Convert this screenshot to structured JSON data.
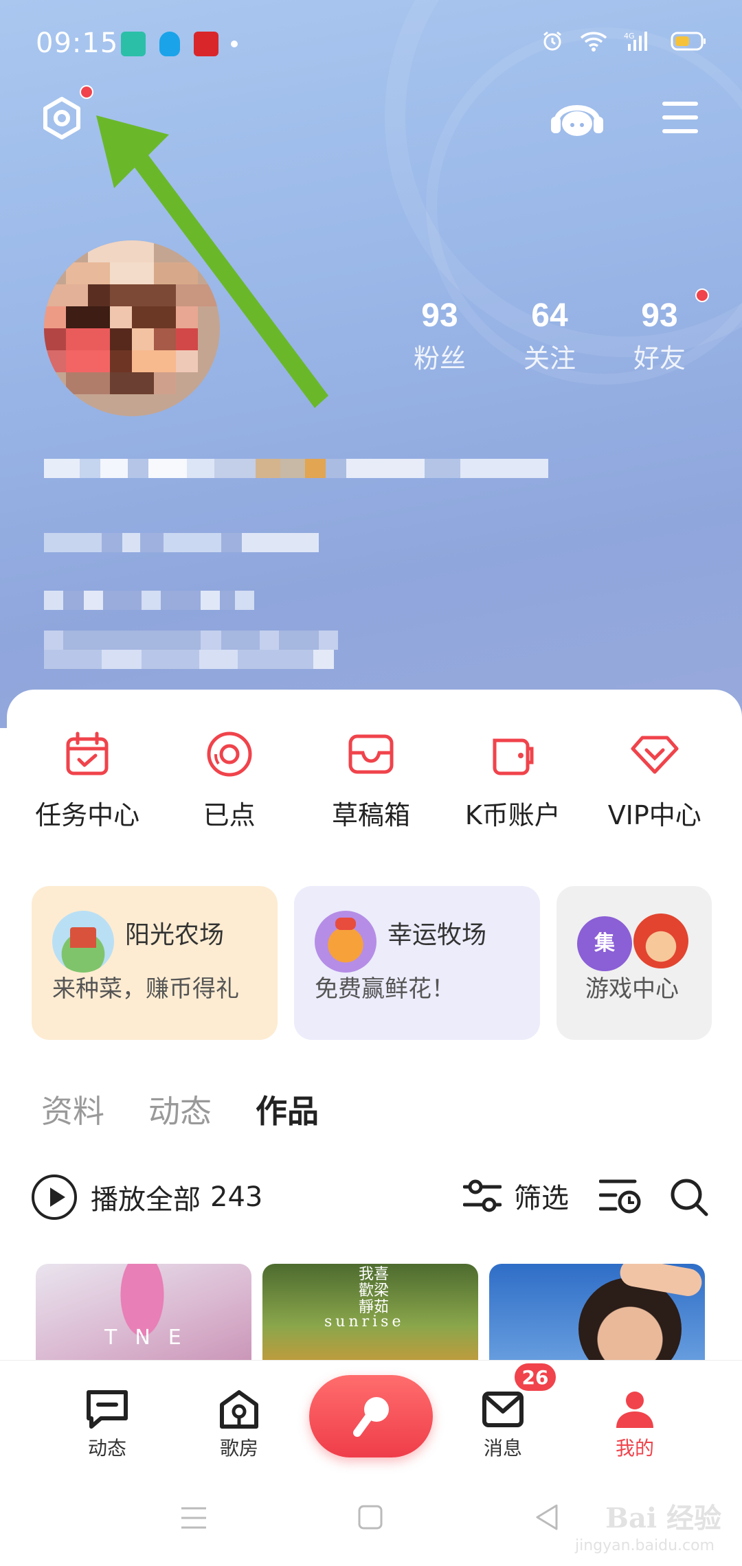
{
  "status_bar": {
    "time": "09:15",
    "app_icons": [
      "boss-zhipin-icon",
      "qq-icon",
      "app-icon",
      "dot"
    ],
    "battery_color": "#f5c23a"
  },
  "header": {
    "settings_icon": "gear-icon",
    "headset_icon": "headset-icon",
    "menu_icon": "menu-icon"
  },
  "profile": {
    "stats": [
      {
        "value": "93",
        "label": "粉丝"
      },
      {
        "value": "64",
        "label": "关注"
      },
      {
        "value": "93",
        "label": "好友"
      }
    ]
  },
  "quick_actions": [
    {
      "label": "任务中心",
      "icon": "calendar-check-icon"
    },
    {
      "label": "已点",
      "icon": "disc-icon"
    },
    {
      "label": "草稿箱",
      "icon": "inbox-icon"
    },
    {
      "label": "K币账户",
      "icon": "wallet-icon"
    },
    {
      "label": "VIP中心",
      "icon": "diamond-icon"
    }
  ],
  "promos": [
    {
      "title": "阳光农场",
      "subtitle": "来种菜，赚币得礼",
      "bg": "#fdecd2"
    },
    {
      "title": "幸运牧场",
      "subtitle": "免费赢鲜花！",
      "bg": "#ececfb"
    },
    {
      "title": "",
      "subtitle": "游戏中心",
      "bg": "#f0f0f0",
      "tile_text": "集"
    }
  ],
  "tabs": [
    "资料",
    "动态",
    "作品"
  ],
  "toolbar": {
    "play_all": "播放全部",
    "count": "243",
    "filter": "筛选"
  },
  "works": [
    {
      "cover_text": "TNE"
    },
    {
      "cover_text": "我喜歡梁靜茹",
      "cover_sub": "sunrise"
    },
    {
      "cover_text": ""
    }
  ],
  "bottom_nav": [
    {
      "label": "动态"
    },
    {
      "label": "歌房"
    },
    {
      "label": "消息"
    },
    {
      "label": "我的"
    }
  ],
  "messages_badge": "26",
  "watermark": {
    "main": "Bai 经验",
    "sub": "jingyan.baidu.com"
  },
  "accent_color": "#f0434b"
}
